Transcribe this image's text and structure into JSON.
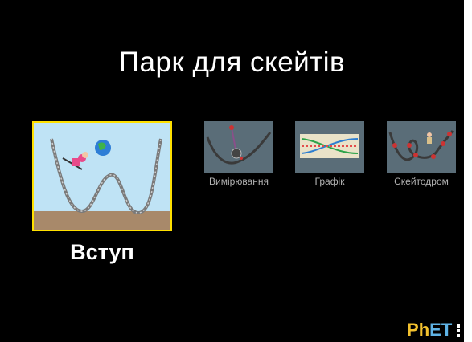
{
  "title": "Парк для скейтів",
  "screens": {
    "intro": {
      "label": "Вступ",
      "selected": true
    },
    "measure": {
      "label": "Вимірювання"
    },
    "graph": {
      "label": "Графік"
    },
    "playground": {
      "label": "Скейтодром"
    }
  },
  "brand": {
    "logo_text": "PhET"
  },
  "colors": {
    "background": "#000000",
    "selected_border": "#ffe000",
    "label_selected": "#ffffff",
    "label_unselected": "#b3b3b3"
  }
}
